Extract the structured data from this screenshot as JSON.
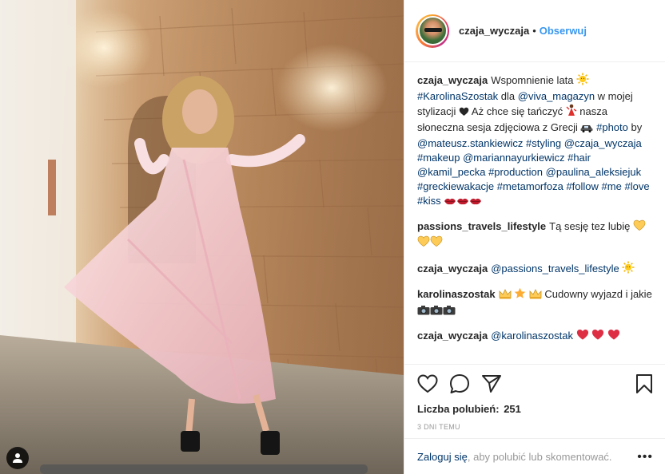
{
  "header": {
    "username": "czaja_wyczaja",
    "dot": "•",
    "follow_label": "Obserwuj"
  },
  "comments": [
    {
      "user": "czaja_wyczaja",
      "parts": [
        {
          "t": "text",
          "v": "Wspomnienie lata "
        },
        {
          "t": "emoji",
          "v": "sun"
        },
        {
          "t": "text",
          "v": " "
        },
        {
          "t": "tag",
          "v": "#KarolinaSzostak"
        },
        {
          "t": "text",
          "v": " dla "
        },
        {
          "t": "tag",
          "v": "@viva_magazyn"
        },
        {
          "t": "text",
          "v": " w mojej stylizacji "
        },
        {
          "t": "emoji",
          "v": "black-heart"
        },
        {
          "t": "text",
          "v": " Aż chce się tańczyć "
        },
        {
          "t": "emoji",
          "v": "dancer"
        },
        {
          "t": "text",
          "v": " nasza słoneczna sesja zdjęciowa z Grecji "
        },
        {
          "t": "emoji",
          "v": "car"
        },
        {
          "t": "text",
          "v": " "
        },
        {
          "t": "tag",
          "v": "#photo"
        },
        {
          "t": "text",
          "v": " by "
        },
        {
          "t": "tag",
          "v": "@mateusz.stankiewicz"
        },
        {
          "t": "text",
          "v": " "
        },
        {
          "t": "tag",
          "v": "#styling"
        },
        {
          "t": "text",
          "v": " "
        },
        {
          "t": "tag",
          "v": "@czaja_wyczaja"
        },
        {
          "t": "text",
          "v": " "
        },
        {
          "t": "tag",
          "v": "#makeup"
        },
        {
          "t": "text",
          "v": " "
        },
        {
          "t": "tag",
          "v": "@mariannayurkiewicz"
        },
        {
          "t": "text",
          "v": " "
        },
        {
          "t": "tag",
          "v": "#hair"
        },
        {
          "t": "text",
          "v": " "
        },
        {
          "t": "tag",
          "v": "@kamil_pecka"
        },
        {
          "t": "text",
          "v": " "
        },
        {
          "t": "tag",
          "v": "#production"
        },
        {
          "t": "text",
          "v": " "
        },
        {
          "t": "tag",
          "v": "@paulina_aleksiejuk"
        },
        {
          "t": "text",
          "v": " "
        },
        {
          "t": "tag",
          "v": "#greckiewakacje"
        },
        {
          "t": "text",
          "v": " "
        },
        {
          "t": "tag",
          "v": "#metamorfoza"
        },
        {
          "t": "text",
          "v": " "
        },
        {
          "t": "tag",
          "v": "#follow"
        },
        {
          "t": "text",
          "v": " "
        },
        {
          "t": "tag",
          "v": "#me"
        },
        {
          "t": "text",
          "v": " "
        },
        {
          "t": "tag",
          "v": "#love"
        },
        {
          "t": "text",
          "v": " "
        },
        {
          "t": "tag",
          "v": "#kiss"
        },
        {
          "t": "text",
          "v": " "
        },
        {
          "t": "emoji",
          "v": "lips"
        },
        {
          "t": "emoji",
          "v": "lips"
        },
        {
          "t": "emoji",
          "v": "lips"
        }
      ]
    },
    {
      "user": "passions_travels_lifestyle",
      "parts": [
        {
          "t": "text",
          "v": "Tą sesję tez lubię "
        },
        {
          "t": "emoji",
          "v": "yellow-heart"
        },
        {
          "t": "text",
          "v": " "
        },
        {
          "t": "emoji",
          "v": "yellow-heart"
        },
        {
          "t": "emoji",
          "v": "yellow-heart"
        }
      ]
    },
    {
      "user": "czaja_wyczaja",
      "parts": [
        {
          "t": "tag",
          "v": "@passions_travels_lifestyle"
        },
        {
          "t": "text",
          "v": " "
        },
        {
          "t": "emoji",
          "v": "sun"
        }
      ]
    },
    {
      "user": "karolinaszostak",
      "parts": [
        {
          "t": "emoji",
          "v": "crown"
        },
        {
          "t": "text",
          "v": " "
        },
        {
          "t": "emoji",
          "v": "star"
        },
        {
          "t": "text",
          "v": " "
        },
        {
          "t": "emoji",
          "v": "crown"
        },
        {
          "t": "text",
          "v": " Cudowny wyjazd i jakie "
        },
        {
          "t": "emoji",
          "v": "camera"
        },
        {
          "t": "emoji",
          "v": "camera"
        },
        {
          "t": "emoji",
          "v": "camera"
        }
      ]
    },
    {
      "user": "czaja_wyczaja",
      "parts": [
        {
          "t": "tag",
          "v": "@karolinaszostak"
        },
        {
          "t": "text",
          "v": " "
        },
        {
          "t": "emoji",
          "v": "red-heart"
        },
        {
          "t": "text",
          "v": " "
        },
        {
          "t": "emoji",
          "v": "red-heart"
        },
        {
          "t": "text",
          "v": " "
        },
        {
          "t": "emoji",
          "v": "red-heart"
        }
      ]
    }
  ],
  "actions": {
    "like_icon": "heart-outline-icon",
    "comment_icon": "comment-bubble-icon",
    "share_icon": "paper-plane-icon",
    "save_icon": "bookmark-icon"
  },
  "likes": {
    "label": "Liczba polubień:",
    "count": "251"
  },
  "time": "3 DNI TEMU",
  "login": {
    "link": "Zaloguj się",
    "text": ", aby polubić lub skomentować.",
    "more": "•••"
  },
  "colors": {
    "link": "#003569",
    "follow": "#3897f0",
    "muted": "#999999",
    "text": "#262626",
    "border": "#efefef"
  }
}
